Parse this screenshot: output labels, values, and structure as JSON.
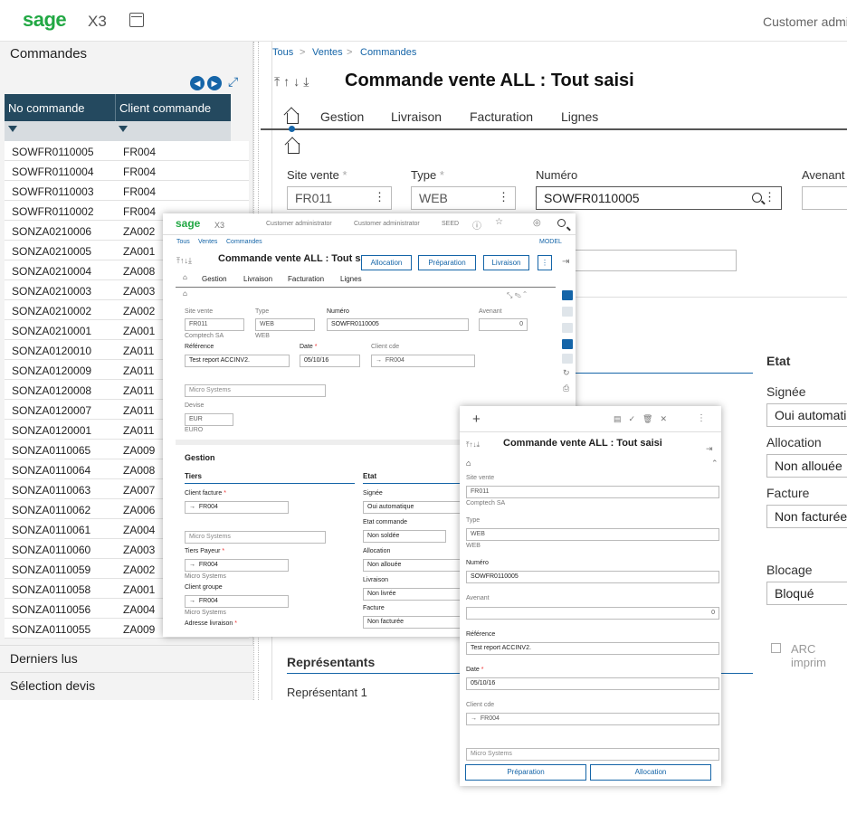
{
  "header": {
    "logo": "sage",
    "product": "X3",
    "user": "Customer admir"
  },
  "left": {
    "title": "Commandes",
    "col1": "No commande",
    "col2": "Client commande",
    "rows": [
      [
        "SOWFR0110005",
        "FR004"
      ],
      [
        "SOWFR0110004",
        "FR004"
      ],
      [
        "SOWFR0110003",
        "FR004"
      ],
      [
        "SOWFR0110002",
        "FR004"
      ],
      [
        "SONZA0210006",
        "ZA002"
      ],
      [
        "SONZA0210005",
        "ZA001"
      ],
      [
        "SONZA0210004",
        "ZA008"
      ],
      [
        "SONZA0210003",
        "ZA003"
      ],
      [
        "SONZA0210002",
        "ZA002"
      ],
      [
        "SONZA0210001",
        "ZA001"
      ],
      [
        "SONZA0120010",
        "ZA011"
      ],
      [
        "SONZA0120009",
        "ZA011"
      ],
      [
        "SONZA0120008",
        "ZA011"
      ],
      [
        "SONZA0120007",
        "ZA011"
      ],
      [
        "SONZA0120001",
        "ZA011"
      ],
      [
        "SONZA0110065",
        "ZA009"
      ],
      [
        "SONZA0110064",
        "ZA008"
      ],
      [
        "SONZA0110063",
        "ZA007"
      ],
      [
        "SONZA0110062",
        "ZA006"
      ],
      [
        "SONZA0110061",
        "ZA004"
      ],
      [
        "SONZA0110060",
        "ZA003"
      ],
      [
        "SONZA0110059",
        "ZA002"
      ],
      [
        "SONZA0110058",
        "ZA001"
      ],
      [
        "SONZA0110056",
        "ZA004"
      ],
      [
        "SONZA0110055",
        "ZA009"
      ]
    ],
    "links": [
      "Derniers lus",
      "Sélection devis"
    ]
  },
  "main": {
    "breadcrumb": [
      "Tous",
      "Ventes",
      "Commandes"
    ],
    "title": "Commande vente ALL : Tout saisi",
    "tabs": [
      "Gestion",
      "Livraison",
      "Facturation",
      "Lignes"
    ],
    "fields": {
      "site_label": "Site vente",
      "site_value": "FR011",
      "type_label": "Type",
      "type_value": "WEB",
      "num_label": "Numéro",
      "num_value": "SOWFR0110005",
      "avenant_label": "Avenant"
    },
    "etat": {
      "title": "Etat",
      "signee_label": "Signée",
      "signee_value": "Oui automati",
      "alloc_label": "Allocation",
      "alloc_value": "Non allouée",
      "facture_label": "Facture",
      "facture_value": "Non facturée",
      "blocage_label": "Blocage",
      "blocage_value": "Bloqué",
      "arc_label": "ARC imprim"
    },
    "representants": {
      "title": "Représentants",
      "rep1": "Représentant 1"
    }
  },
  "mid": {
    "logo": "sage",
    "product": "X3",
    "user1": "Customer administrator",
    "user2": "Customer administrator",
    "seed": "SEED",
    "model": "MODEL",
    "breadcrumb": [
      "Tous",
      "Ventes",
      "Commandes"
    ],
    "title": "Commande vente ALL : Tout sa...",
    "btn_alloc": "Allocation",
    "btn_prep": "Préparation",
    "btn_liv": "Livraison",
    "tabs": [
      "Gestion",
      "Livraison",
      "Facturation",
      "Lignes"
    ],
    "site_label": "Site vente",
    "site_value": "FR011",
    "site_sub": "Comptech SA",
    "type_label": "Type",
    "type_value": "WEB",
    "type_sub": "WEB",
    "num_label": "Numéro",
    "num_value": "SOWFR0110005",
    "avenant_label": "Avenant",
    "avenant_value": "0",
    "ref_label": "Référence",
    "ref_value": "Test report ACCINV2.",
    "date_label": "Date",
    "date_value": "05/10/16",
    "client_label": "Client cde",
    "client_value": "FR004",
    "micro": "Micro Systems",
    "devise_label": "Devise",
    "devise_value": "EUR",
    "devise_sub": "EURO",
    "gestion": "Gestion",
    "tiers": "Tiers",
    "etat": "Etat",
    "cf_label": "Client facture",
    "cf_value": "FR004",
    "tp_label": "Tiers Payeur",
    "tp_value": "FR004",
    "tp_sub": "Micro Systems",
    "cg_label": "Client groupe",
    "cg_value": "FR004",
    "cg_sub": "Micro Systems",
    "al_label": "Adresse livraison",
    "signee_label": "Signée",
    "signee_value": "Oui automatique",
    "etatcde_label": "Etat commande",
    "etatcde_value": "Non soldée",
    "alloc_label": "Allocation",
    "alloc_value": "Non allouée",
    "liv_label": "Livraison",
    "liv_value": "Non livrée",
    "fact_label": "Facture",
    "fact_value": "Non facturée"
  },
  "small": {
    "title": "Commande vente ALL : Tout saisi",
    "site_label": "Site vente",
    "site_value": "FR011",
    "site_sub": "Comptech SA",
    "type_label": "Type",
    "type_value": "WEB",
    "type_sub": "WEB",
    "num_label": "Numéro",
    "num_value": "SOWFR0110005",
    "avenant_label": "Avenant",
    "avenant_value": "0",
    "ref_label": "Référence",
    "ref_value": "Test report ACCINV2.",
    "date_label": "Date",
    "date_value": "05/10/16",
    "client_label": "Client cde",
    "client_value": "FR004",
    "micro": "Micro Systems",
    "btn_prep": "Préparation",
    "btn_alloc": "Allocation"
  }
}
